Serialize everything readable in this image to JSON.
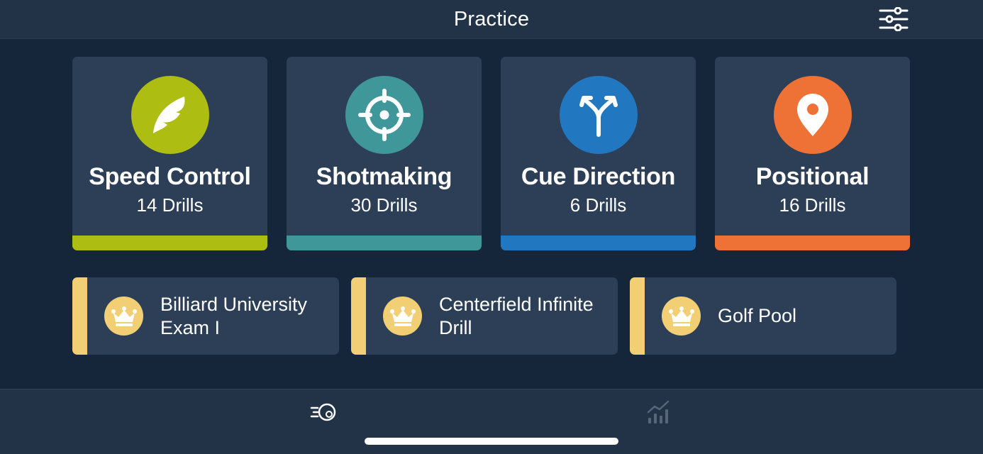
{
  "header": {
    "title": "Practice",
    "filter_icon": "sliders-icon"
  },
  "categories": [
    {
      "name": "Speed Control",
      "count": "14 Drills",
      "icon": "feather-icon",
      "color": "#aebd12"
    },
    {
      "name": "Shotmaking",
      "count": "30 Drills",
      "icon": "crosshair-icon",
      "color": "#3f979a"
    },
    {
      "name": "Cue Direction",
      "count": "6 Drills",
      "icon": "split-arrow-icon",
      "color": "#2278c0"
    },
    {
      "name": "Positional",
      "count": "16 Drills",
      "icon": "map-pin-icon",
      "color": "#ee7236"
    }
  ],
  "programs": [
    {
      "label": "Billiard University\nExam I",
      "icon": "crown-icon"
    },
    {
      "label": "Centerfield Infinite\nDrill",
      "icon": "crown-icon"
    },
    {
      "label": "Golf Pool",
      "icon": "crown-icon"
    }
  ],
  "program_accent": "#f2cf74",
  "tabbar": {
    "tabs": [
      {
        "name": "practice",
        "icon": "moving-ball-icon",
        "active": true
      },
      {
        "name": "stats",
        "icon": "bar-chart-icon",
        "active": false
      }
    ]
  }
}
